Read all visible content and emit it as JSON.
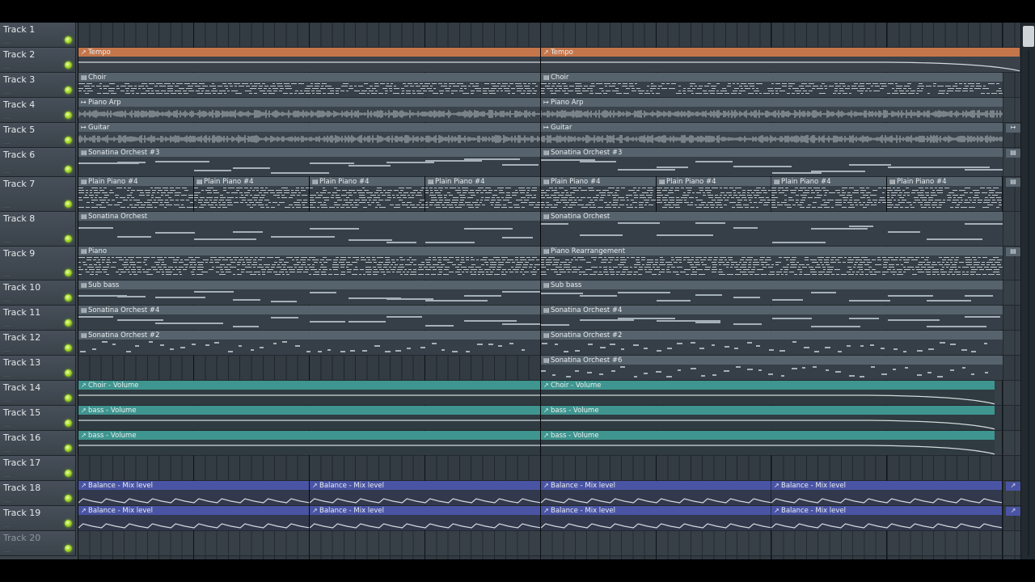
{
  "tracks": [
    {
      "name": "Track 1",
      "dots": "...",
      "dim": false
    },
    {
      "name": "Track 2",
      "dots": "...",
      "dim": false
    },
    {
      "name": "Track 3",
      "dots": "...",
      "dim": false
    },
    {
      "name": "Track 4",
      "dots": "...",
      "dim": false
    },
    {
      "name": "Track 5",
      "dots": "...",
      "dim": false
    },
    {
      "name": "Track 6",
      "dots": "...",
      "dim": false
    },
    {
      "name": "Track 7",
      "dots": "...",
      "dim": false
    },
    {
      "name": "Track 8",
      "dots": "...",
      "dim": false
    },
    {
      "name": "Track 9",
      "dots": "...",
      "dim": false
    },
    {
      "name": "Track 10",
      "dots": "...",
      "dim": false
    },
    {
      "name": "Track 11",
      "dots": "...",
      "dim": false
    },
    {
      "name": "Track 12",
      "dots": "...",
      "dim": false
    },
    {
      "name": "Track 13",
      "dots": "...",
      "dim": false
    },
    {
      "name": "Track 14",
      "dots": "...",
      "dim": false
    },
    {
      "name": "Track 15",
      "dots": "...",
      "dim": false
    },
    {
      "name": "Track 16",
      "dots": "...",
      "dim": false
    },
    {
      "name": "Track 17",
      "dots": "...",
      "dim": false
    },
    {
      "name": "Track 18",
      "dots": "...",
      "dim": false
    },
    {
      "name": "Track 19",
      "dots": "...",
      "dim": false
    },
    {
      "name": "Track 20",
      "dots": "...",
      "dim": true
    }
  ],
  "clips": [
    {
      "track": 2,
      "type": "tempo",
      "label": "Tempo",
      "icon": "automation-icon",
      "start": 0,
      "len": 4
    },
    {
      "track": 2,
      "type": "tempo",
      "label": "Tempo",
      "icon": "automation-icon",
      "start": 4,
      "len": 4.15
    },
    {
      "track": 3,
      "type": "pattern",
      "label": "Choir",
      "icon": "pattern-icon",
      "start": 0,
      "len": 4
    },
    {
      "track": 3,
      "type": "pattern",
      "label": "Choir",
      "icon": "pattern-icon",
      "start": 4,
      "len": 4
    },
    {
      "track": 4,
      "type": "audio",
      "label": "Piano Arp",
      "icon": "audio-clip-icon",
      "start": 0,
      "len": 4
    },
    {
      "track": 4,
      "type": "audio",
      "label": "Piano Arp",
      "icon": "audio-clip-icon",
      "start": 4,
      "len": 4
    },
    {
      "track": 5,
      "type": "audio",
      "label": "Guitar",
      "icon": "audio-clip-icon",
      "start": 0,
      "len": 4
    },
    {
      "track": 5,
      "type": "audio",
      "label": "Guitar",
      "icon": "audio-clip-icon",
      "start": 4,
      "len": 4
    },
    {
      "track": 6,
      "type": "pattern",
      "label": "Sonatina Orchest #3",
      "icon": "pattern-icon",
      "start": 0,
      "len": 4
    },
    {
      "track": 6,
      "type": "pattern",
      "label": "Sonatina Orchest #3",
      "icon": "pattern-icon",
      "start": 4,
      "len": 4
    },
    {
      "track": 7,
      "type": "pattern",
      "label": "Plain Piano #4",
      "icon": "pattern-icon",
      "start": 0,
      "len": 1
    },
    {
      "track": 7,
      "type": "pattern",
      "label": "Plain Piano #4",
      "icon": "pattern-icon",
      "start": 1,
      "len": 1
    },
    {
      "track": 7,
      "type": "pattern",
      "label": "Plain Piano #4",
      "icon": "pattern-icon",
      "start": 2,
      "len": 1
    },
    {
      "track": 7,
      "type": "pattern",
      "label": "Plain Piano #4",
      "icon": "pattern-icon",
      "start": 3,
      "len": 1
    },
    {
      "track": 7,
      "type": "pattern",
      "label": "Plain Piano #4",
      "icon": "pattern-icon",
      "start": 4,
      "len": 1
    },
    {
      "track": 7,
      "type": "pattern",
      "label": "Plain Piano #4",
      "icon": "pattern-icon",
      "start": 5,
      "len": 1
    },
    {
      "track": 7,
      "type": "pattern",
      "label": "Plain Piano #4",
      "icon": "pattern-icon",
      "start": 6,
      "len": 1
    },
    {
      "track": 7,
      "type": "pattern",
      "label": "Plain Piano #4",
      "icon": "pattern-icon",
      "start": 7,
      "len": 1
    },
    {
      "track": 8,
      "type": "pattern",
      "label": "Sonatina Orchest",
      "icon": "pattern-icon",
      "start": 0,
      "len": 4
    },
    {
      "track": 8,
      "type": "pattern",
      "label": "Sonatina Orchest",
      "icon": "pattern-icon",
      "start": 4,
      "len": 4
    },
    {
      "track": 9,
      "type": "pattern",
      "label": "Piano",
      "icon": "pattern-icon",
      "start": 0,
      "len": 4
    },
    {
      "track": 9,
      "type": "pattern",
      "label": "Piano Rearrangement",
      "icon": "pattern-icon",
      "start": 4,
      "len": 4
    },
    {
      "track": 10,
      "type": "pattern",
      "label": "Sub bass",
      "icon": "pattern-icon",
      "start": 0,
      "len": 4
    },
    {
      "track": 10,
      "type": "pattern",
      "label": "Sub bass",
      "icon": "pattern-icon",
      "start": 4,
      "len": 4
    },
    {
      "track": 11,
      "type": "pattern",
      "label": "Sonatina Orchest #4",
      "icon": "pattern-icon",
      "start": 0,
      "len": 4
    },
    {
      "track": 11,
      "type": "pattern",
      "label": "Sonatina Orchest #4",
      "icon": "pattern-icon",
      "start": 4,
      "len": 4
    },
    {
      "track": 12,
      "type": "pattern",
      "label": "Sonatina Orchest #2",
      "icon": "pattern-icon",
      "start": 0,
      "len": 4
    },
    {
      "track": 12,
      "type": "pattern",
      "label": "Sonatina Orchest #2",
      "icon": "pattern-icon",
      "start": 4,
      "len": 4
    },
    {
      "track": 13,
      "type": "pattern",
      "label": "Sonatina Orchest #6",
      "icon": "pattern-icon",
      "start": 4,
      "len": 4
    },
    {
      "track": 14,
      "type": "vol",
      "label": "Choir - Volume",
      "icon": "automation-icon",
      "start": 0,
      "len": 4
    },
    {
      "track": 14,
      "type": "vol",
      "label": "Choir - Volume",
      "icon": "automation-icon",
      "start": 4,
      "len": 3.93
    },
    {
      "track": 15,
      "type": "vol",
      "label": "bass - Volume",
      "icon": "automation-icon",
      "start": 0,
      "len": 4
    },
    {
      "track": 15,
      "type": "vol",
      "label": "bass - Volume",
      "icon": "automation-icon",
      "start": 4,
      "len": 3.93
    },
    {
      "track": 16,
      "type": "vol",
      "label": "bass - Volume",
      "icon": "automation-icon",
      "start": 0,
      "len": 4
    },
    {
      "track": 16,
      "type": "vol",
      "label": "bass - Volume",
      "icon": "automation-icon",
      "start": 4,
      "len": 3.93
    },
    {
      "track": 18,
      "type": "mix",
      "label": "Balance - Mix level",
      "icon": "automation-icon",
      "start": 0,
      "len": 2
    },
    {
      "track": 18,
      "type": "mix",
      "label": "Balance - Mix level",
      "icon": "automation-icon",
      "start": 2,
      "len": 2
    },
    {
      "track": 18,
      "type": "mix",
      "label": "Balance - Mix level",
      "icon": "automation-icon",
      "start": 4,
      "len": 2
    },
    {
      "track": 18,
      "type": "mix",
      "label": "Balance - Mix level",
      "icon": "automation-icon",
      "start": 6,
      "len": 2
    },
    {
      "track": 19,
      "type": "mix",
      "label": "Balance - Mix level",
      "icon": "automation-icon",
      "start": 0,
      "len": 2
    },
    {
      "track": 19,
      "type": "mix",
      "label": "Balance - Mix level",
      "icon": "automation-icon",
      "start": 2,
      "len": 2
    },
    {
      "track": 19,
      "type": "mix",
      "label": "Balance - Mix level",
      "icon": "automation-icon",
      "start": 4,
      "len": 2
    },
    {
      "track": 19,
      "type": "mix",
      "label": "Balance - Mix level",
      "icon": "automation-icon",
      "start": 6,
      "len": 2
    }
  ],
  "end_caps": [
    {
      "track": 5,
      "icon": "audio-clip-icon"
    },
    {
      "track": 6,
      "icon": "pattern-icon"
    },
    {
      "track": 7,
      "icon": "pattern-icon"
    },
    {
      "track": 9,
      "icon": "pattern-icon"
    },
    {
      "track": 18,
      "icon": "automation-icon"
    },
    {
      "track": 19,
      "icon": "automation-icon"
    }
  ],
  "colors": {
    "tempo": "#c4754a",
    "volume": "#3f958f",
    "mix": "#4a54a4",
    "pattern": "#56626c",
    "mute_led": "#a4d828"
  }
}
